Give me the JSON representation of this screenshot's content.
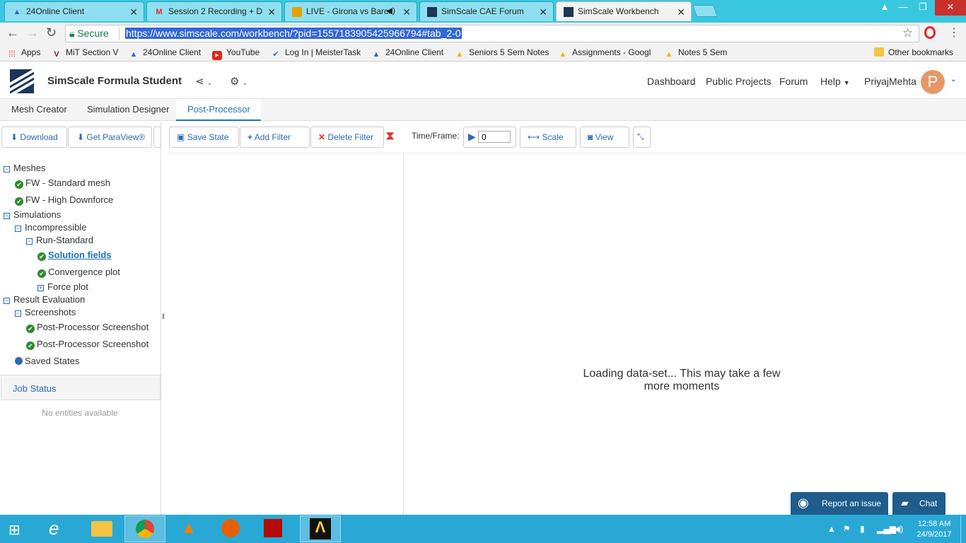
{
  "browser": {
    "tabs": [
      {
        "title": "24Online Client",
        "icon": "24online-icon"
      },
      {
        "title": "Session 2 Recording + D",
        "icon": "gmail-icon"
      },
      {
        "title": "LIVE - Girona vs Barce",
        "icon": "video-icon"
      },
      {
        "title": "SimScale CAE Forum",
        "icon": "simscale-icon"
      },
      {
        "title": "SimScale Workbench",
        "icon": "simscale-icon"
      }
    ],
    "secure_label": "Secure",
    "url": "https://www.simscale.com/workbench/?pid=1557183905425966794#tab_2-0",
    "bookmarks": [
      {
        "label": "Apps"
      },
      {
        "label": "MiT Section V"
      },
      {
        "label": "24Online Client"
      },
      {
        "label": "YouTube"
      },
      {
        "label": "Log In | MeisterTask"
      },
      {
        "label": "24Online Client"
      },
      {
        "label": "Seniors 5 Sem Notes"
      },
      {
        "label": "Assignments - Googl"
      },
      {
        "label": "Notes 5 Sem"
      }
    ],
    "other_bookmarks": "Other bookmarks"
  },
  "app": {
    "title": "SimScale Formula Student",
    "nav": [
      "Dashboard",
      "Public Projects",
      "Forum",
      "Help"
    ],
    "user": "PriyajMehta",
    "avatar_letter": "P"
  },
  "crumbs": [
    "Mesh Creator",
    "Simulation Designer",
    "Post-Processor"
  ],
  "left": {
    "download": "Download",
    "paraview": "Get ParaView®",
    "tree": {
      "meshes": "Meshes",
      "mesh1": "FW - Standard mesh",
      "mesh2": "FW - High Downforce",
      "simulations": "Simulations",
      "incompressible": "Incompressible",
      "run": "Run-Standard",
      "solution_fields": "Solution fields",
      "convergence": "Convergence plot",
      "force": "Force plot",
      "result_eval": "Result Evaluation",
      "screenshots": "Screenshots",
      "shot1": "Post-Processor Screenshot",
      "shot2": "Post-Processor Screenshot",
      "saved_states": "Saved States"
    },
    "job_status": "Job Status",
    "no_entities": "No entities available"
  },
  "toolbar": {
    "save_state": "Save State",
    "add_filter": "Add Filter",
    "delete_filter": "Delete Filter",
    "time_label": "Time/Frame:",
    "frame_value": "0",
    "scale": "Scale",
    "view": "View"
  },
  "viewport": {
    "loading": "Loading data-set... This may take a few more moments"
  },
  "support": {
    "report": "Report an issue",
    "chat": "Chat"
  },
  "taskbar": {
    "time": "12:58 AM",
    "date": "24/9/2017"
  },
  "colors": {
    "accent": "#1e73be",
    "check": "#2e8b2e",
    "tabbar": "#39c7e0",
    "taskbar": "#29a8d6"
  }
}
